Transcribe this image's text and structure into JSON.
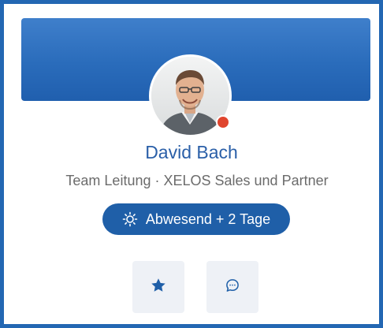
{
  "profile": {
    "name": "David Bach",
    "role": "Team Leitung · XELOS Sales und Partner",
    "presence": "away"
  },
  "status": {
    "icon": "sun-icon",
    "label": "Abwesend + 2 Tage"
  },
  "actions": {
    "favorite_icon": "star-icon",
    "chat_icon": "chat-bubble-icon"
  },
  "colors": {
    "frame": "#2367b3",
    "banner": "#2a6cbb",
    "name": "#2a5fa8",
    "status_pill": "#1f5fa8",
    "presence_dot": "#e0452e",
    "action_bg": "#eef1f6"
  }
}
